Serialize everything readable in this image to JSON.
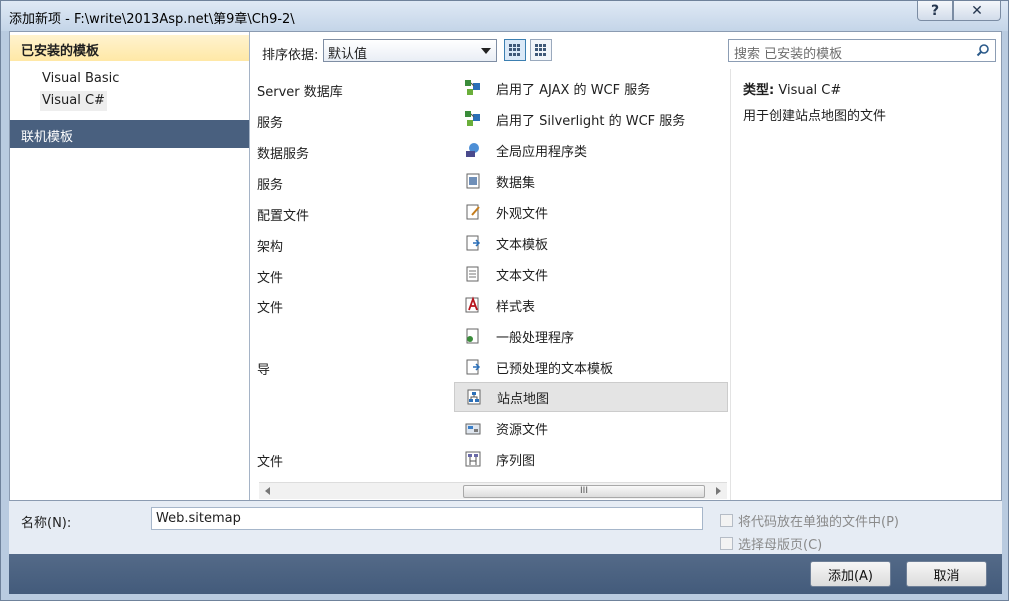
{
  "window": {
    "title": "添加新项 - F:\\write\\2013Asp.net\\第9章\\Ch9-2\\",
    "help_glyph": "?",
    "close_glyph": "✕"
  },
  "left_panel": {
    "installed_header": "已安装的模板",
    "items": [
      {
        "label": "Visual Basic",
        "selected": false
      },
      {
        "label": "Visual C#",
        "selected": true
      }
    ],
    "online_header": "联机模板"
  },
  "toolbar": {
    "sort_label": "排序依据:",
    "sort_value": "默认值",
    "search_placeholder": "搜索 已安装的模板"
  },
  "list": {
    "col1": [
      "Server 数据库",
      "服务",
      "数据服务",
      "服务",
      "配置文件",
      "架构",
      "文件",
      "文件",
      "",
      "导",
      "",
      "",
      "文件"
    ],
    "col2": [
      {
        "label": "启用了 AJAX 的 WCF 服务",
        "icon": "wcf-service-icon",
        "selected": false
      },
      {
        "label": "启用了 Silverlight 的 WCF 服务",
        "icon": "wcf-service-icon",
        "selected": false
      },
      {
        "label": "全局应用程序类",
        "icon": "global-app-class-icon",
        "selected": false
      },
      {
        "label": "数据集",
        "icon": "dataset-icon",
        "selected": false
      },
      {
        "label": "外观文件",
        "icon": "skin-file-icon",
        "selected": false
      },
      {
        "label": "文本模板",
        "icon": "text-template-icon",
        "selected": false
      },
      {
        "label": "文本文件",
        "icon": "text-file-icon",
        "selected": false
      },
      {
        "label": "样式表",
        "icon": "stylesheet-icon",
        "selected": false
      },
      {
        "label": "一般处理程序",
        "icon": "handler-icon",
        "selected": false
      },
      {
        "label": "已预处理的文本模板",
        "icon": "preprocessed-template-icon",
        "selected": false
      },
      {
        "label": "站点地图",
        "icon": "sitemap-icon",
        "selected": true
      },
      {
        "label": "资源文件",
        "icon": "resource-file-icon",
        "selected": false
      },
      {
        "label": "序列图",
        "icon": "sequence-diagram-icon",
        "selected": false
      }
    ],
    "scroll_thumb_glyph": "III"
  },
  "description": {
    "type_label": "类型:",
    "type_value": "Visual C#",
    "text": "用于创建站点地图的文件"
  },
  "bottom": {
    "name_label": "名称(N):",
    "name_value": "Web.sitemap",
    "checkbox1": "将代码放在单独的文件中(P)",
    "checkbox2": "选择母版页(C)"
  },
  "buttons": {
    "add": "添加(A)",
    "cancel": "取消"
  },
  "colors": {
    "installed_header": "#ffe8a6",
    "online_header": "#49607f",
    "footer": "#435b7b"
  }
}
